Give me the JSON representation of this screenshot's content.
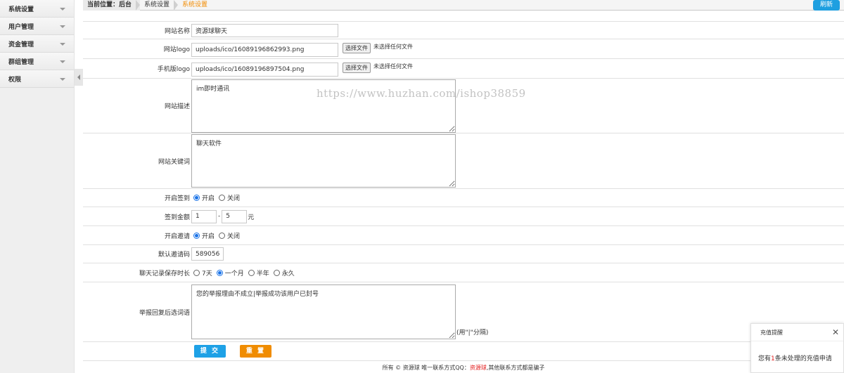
{
  "sidebar": {
    "items": [
      {
        "label": "系统设置"
      },
      {
        "label": "用户管理"
      },
      {
        "label": "资金管理"
      },
      {
        "label": "群组管理"
      },
      {
        "label": "权限"
      }
    ]
  },
  "breadcrumb": {
    "prefix": "当前位置：后台",
    "level1": "系统设置",
    "current": "系统设置"
  },
  "toolbar": {
    "refresh_label": "刷新"
  },
  "form": {
    "site_name": {
      "label": "网站名称",
      "value": "资源球聊天"
    },
    "site_logo": {
      "label": "网站logo",
      "value": "uploads/ico/16089196862993.png",
      "button": "选择文件",
      "status": "未选择任何文件"
    },
    "mobile_logo": {
      "label": "手机版logo",
      "value": "uploads/ico/16089196897504.png",
      "button": "选择文件",
      "status": "未选择任何文件"
    },
    "site_desc": {
      "label": "网站描述",
      "value": "im即时通讯"
    },
    "site_keywords": {
      "label": "网站关键词",
      "value": "聊天软件"
    },
    "checkin": {
      "label": "开启签到",
      "opt_on": "开启",
      "opt_off": "关闭",
      "selected": "on"
    },
    "checkin_amount": {
      "label": "签到金额",
      "min": "1",
      "sep": "-",
      "max": "5",
      "unit": "元"
    },
    "invite": {
      "label": "开启邀请",
      "opt_on": "开启",
      "opt_off": "关闭",
      "selected": "on"
    },
    "default_invite": {
      "label": "默认邀请码",
      "value": "589056"
    },
    "chat_retention": {
      "label": "聊天记录保存时长",
      "options": [
        "7天",
        "一个月",
        "半年",
        "永久"
      ],
      "selected": "一个月"
    },
    "report_reply": {
      "label": "举报回复后选词语",
      "value": "您的举报理由不成立|举报成功该用户已封号",
      "hint": "(用\"|\"分隔)"
    },
    "submit_label": "提 交",
    "reset_label": "重 置"
  },
  "watermark": "https://www.huzhan.com/ishop38859",
  "footer": {
    "prefix": "所有 © 资源球 唯一联系方式QQ：",
    "highlight": "资源球",
    "suffix": ",其他联系方式都是骗子"
  },
  "popup": {
    "title": "充值提醒",
    "close": "✕",
    "msg_prefix": "您有",
    "count": "1",
    "msg_suffix": "条未处理的充值申请"
  },
  "colors": {
    "accent": "#1ea1e6",
    "reset": "#f08c00",
    "breadcrumb_current": "#f28b00",
    "alert": "#e21919"
  }
}
